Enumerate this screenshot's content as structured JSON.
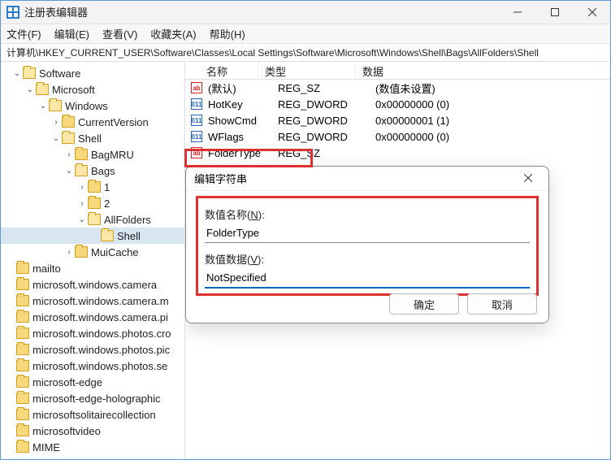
{
  "window": {
    "title": "注册表编辑器"
  },
  "menu": {
    "file": "文件(F)",
    "edit": "编辑(E)",
    "view": "查看(V)",
    "favorites": "收藏夹(A)",
    "help": "帮助(H)"
  },
  "path": "计算机\\HKEY_CURRENT_USER\\Software\\Classes\\Local Settings\\Software\\Microsoft\\Windows\\Shell\\Bags\\AllFolders\\Shell",
  "tree": {
    "software": "Software",
    "microsoft": "Microsoft",
    "windows": "Windows",
    "currentversion": "CurrentVersion",
    "shell": "Shell",
    "bagmru": "BagMRU",
    "bags": "Bags",
    "one": "1",
    "two": "2",
    "allfolders": "AllFolders",
    "shell2": "Shell",
    "muicache": "MuiCache",
    "mailto": "mailto",
    "mwc": "microsoft.windows.camera",
    "mwcm": "microsoft.windows.camera.m",
    "mwcp": "microsoft.windows.camera.pi",
    "mwphc": "microsoft.windows.photos.cro",
    "mwphp": "microsoft.windows.photos.pic",
    "mwphs": "microsoft.windows.photos.se",
    "medge": "microsoft-edge",
    "medgeh": "microsoft-edge-holographic",
    "msol": "microsoftsolitairecollection",
    "mvid": "microsoftvideo",
    "mime": "MIME"
  },
  "columns": {
    "name": "名称",
    "type": "类型",
    "data": "数据"
  },
  "values": {
    "default_name": "(默认)",
    "default_type": "REG_SZ",
    "default_data": "(数值未设置)",
    "hotkey_name": "HotKey",
    "hotkey_type": "REG_DWORD",
    "hotkey_data": "0x00000000 (0)",
    "showcmd_name": "ShowCmd",
    "showcmd_type": "REG_DWORD",
    "showcmd_data": "0x00000001 (1)",
    "wflags_name": "WFlags",
    "wflags_type": "REG_DWORD",
    "wflags_data": "0x00000000 (0)",
    "foldertype_name": "FolderType",
    "foldertype_type": "REG_SZ",
    "foldertype_data": ""
  },
  "dialog": {
    "title": "编辑字符串",
    "name_label_pre": "数值名称(",
    "name_label_key": "N",
    "name_label_post": "):",
    "name_value": "FolderType",
    "data_label_pre": "数值数据(",
    "data_label_key": "V",
    "data_label_post": "):",
    "data_value": "NotSpecified",
    "ok": "确定",
    "cancel": "取消"
  },
  "icons": {
    "ab": "ab",
    "bin": "011"
  }
}
